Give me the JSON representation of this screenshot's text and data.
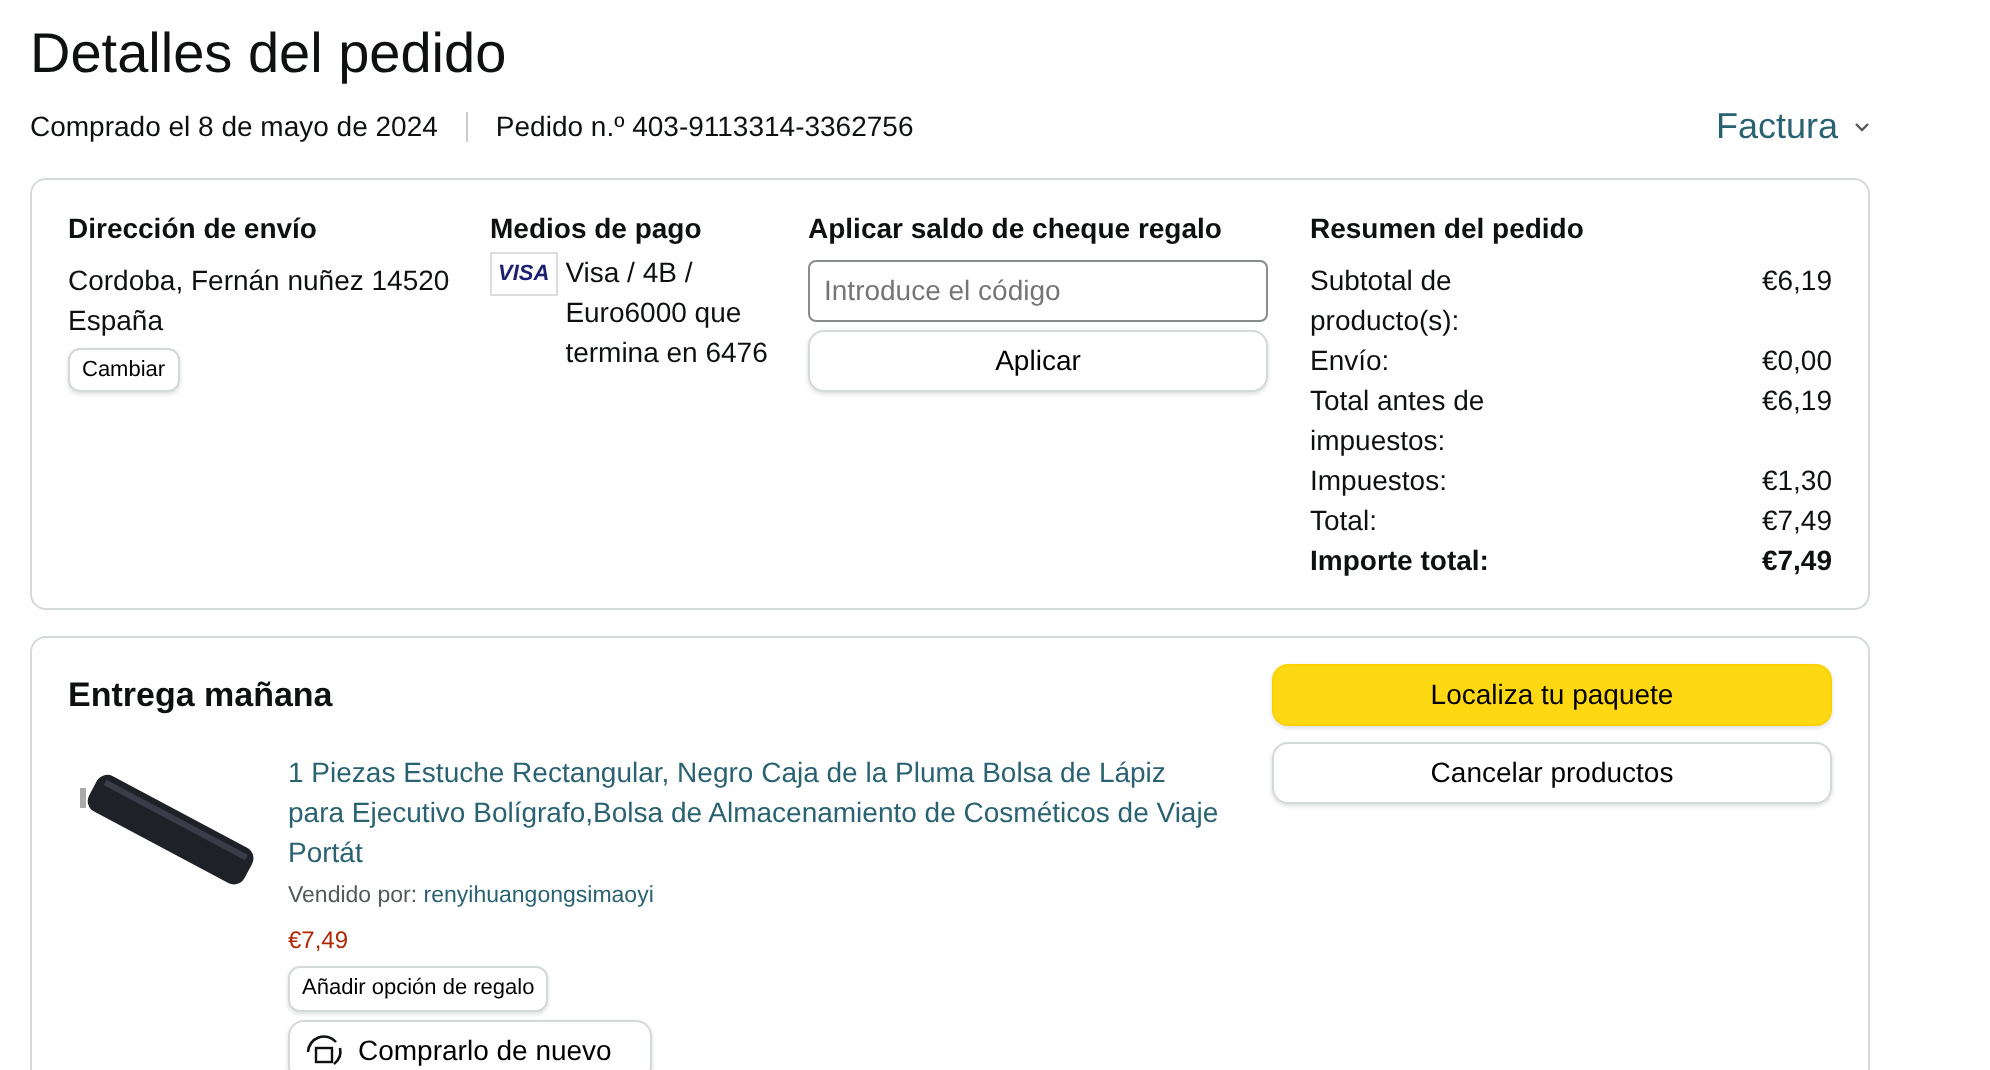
{
  "page_title": "Detalles del pedido",
  "purchase_date": "Comprado el 8 de mayo de 2024",
  "order_number": "Pedido n.º 403-9113314-3362756",
  "invoice_link": "Factura",
  "shipping": {
    "heading": "Dirección de envío",
    "lines": [
      "Cordoba, Fernán nuñez 14520",
      "España"
    ],
    "button": "Cambiar"
  },
  "payment": {
    "heading": "Medios de pago",
    "card_brand": "VISA",
    "text": "Visa / 4B / Euro6000  que termina en 6476"
  },
  "gift_card": {
    "heading": "Aplicar saldo de cheque regalo",
    "placeholder": "Introduce el código",
    "button": "Aplicar"
  },
  "summary": {
    "heading": "Resumen del pedido",
    "rows": [
      {
        "label": "Subtotal de producto(s):",
        "value": "€6,19",
        "bold": false
      },
      {
        "label": "Envío:",
        "value": "€0,00",
        "bold": false
      },
      {
        "label": "Total antes de impuestos:",
        "value": "€6,19",
        "bold": false
      },
      {
        "label": "Impuestos:",
        "value": "€1,30",
        "bold": false
      },
      {
        "label": "Total:",
        "value": "€7,49",
        "bold": false
      },
      {
        "label": "Importe total:",
        "value": "€7,49",
        "bold": true
      }
    ]
  },
  "shipment": {
    "heading": "Entrega mañana",
    "buttons": [
      {
        "label": "Localiza tu paquete",
        "kind": "primary"
      },
      {
        "label": "Cancelar productos",
        "kind": "secondary"
      }
    ],
    "items": [
      {
        "title": "1 Piezas Estuche Rectangular, Negro Caja de la Pluma Bolsa de Lápiz para Ejecutivo Bolígrafo,Bolsa de Almacenamiento de Cosméticos de Viaje Portát",
        "sold_by_label": "Vendido por:",
        "seller": "renyihuangongsimaoyi",
        "price": "€7,49",
        "gift_button": "Añadir opción de regalo",
        "buy_again_button": "Comprarlo de nuevo"
      }
    ]
  }
}
